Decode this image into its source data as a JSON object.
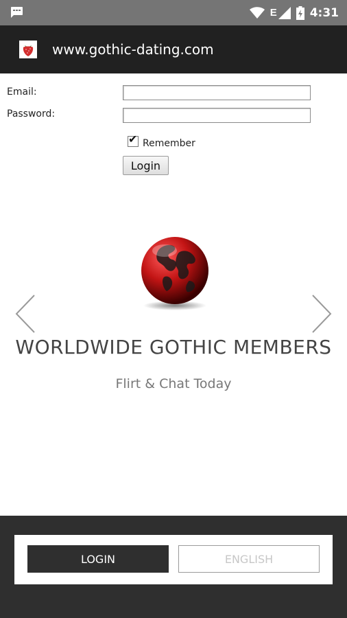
{
  "status_bar": {
    "time": "4:31",
    "network": "E",
    "icons": [
      "message-icon",
      "wifi-icon",
      "signal-icon",
      "battery-icon"
    ]
  },
  "app_bar": {
    "title": "www.gothic-dating.com",
    "icon": "strawberry-icon"
  },
  "login_form": {
    "email_label": "Email:",
    "email_value": "",
    "password_label": "Password:",
    "password_value": "",
    "remember_label": "Remember",
    "remember_checked": true,
    "submit_label": "Login"
  },
  "carousel": {
    "title": "WORLDWIDE GOTHIC MEMBERS",
    "subtitle": "Flirt & Chat Today",
    "image": "globe-icon"
  },
  "footer": {
    "login_label": "LOGIN",
    "language_label": "ENGLISH"
  },
  "colors": {
    "status_bar": "#757575",
    "app_bar": "#212121",
    "footer": "#2f2f2f",
    "globe_red": "#d11d1d"
  }
}
